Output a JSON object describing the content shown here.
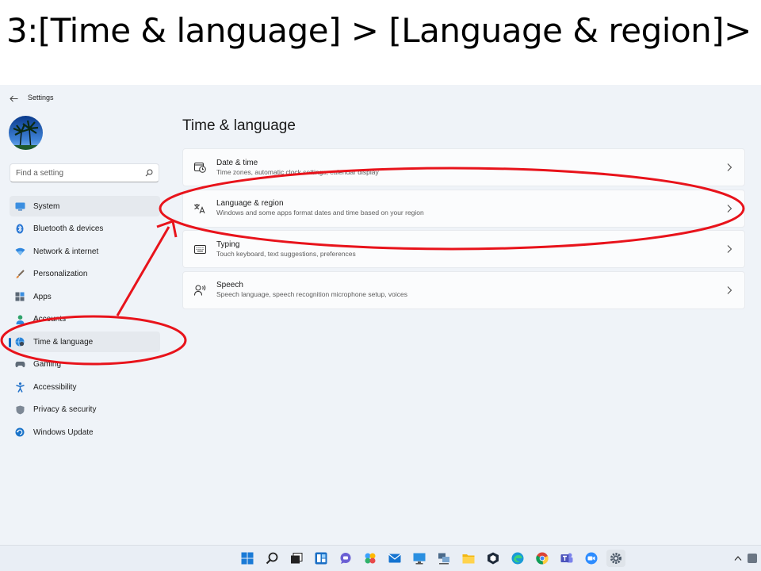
{
  "slide": {
    "title": "3:[Time & language] > [Language & region]>"
  },
  "window": {
    "app_title": "Settings"
  },
  "search": {
    "placeholder": "Find a setting"
  },
  "sidebar": {
    "items": [
      {
        "label": "System",
        "icon": "monitor-icon"
      },
      {
        "label": "Bluetooth & devices",
        "icon": "bluetooth-icon"
      },
      {
        "label": "Network & internet",
        "icon": "wifi-icon"
      },
      {
        "label": "Personalization",
        "icon": "brush-icon"
      },
      {
        "label": "Apps",
        "icon": "apps-icon"
      },
      {
        "label": "Accounts",
        "icon": "person-icon"
      },
      {
        "label": "Time & language",
        "icon": "globe-clock-icon",
        "selected": true
      },
      {
        "label": "Gaming",
        "icon": "gamepad-icon"
      },
      {
        "label": "Accessibility",
        "icon": "accessibility-icon"
      },
      {
        "label": "Privacy & security",
        "icon": "shield-icon"
      },
      {
        "label": "Windows Update",
        "icon": "update-icon"
      }
    ]
  },
  "main": {
    "heading": "Time & language",
    "cards": [
      {
        "title": "Date & time",
        "desc": "Time zones, automatic clock settings, calendar display",
        "icon": "calendar-clock-icon"
      },
      {
        "title": "Language & region",
        "desc": "Windows and some apps format dates and time based on your region",
        "icon": "language-icon"
      },
      {
        "title": "Typing",
        "desc": "Touch keyboard, text suggestions, preferences",
        "icon": "keyboard-icon"
      },
      {
        "title": "Speech",
        "desc": "Speech language, speech recognition microphone setup, voices",
        "icon": "speech-icon"
      }
    ]
  },
  "taskbar": {
    "icons": [
      "start-icon",
      "search-icon",
      "task-view-icon",
      "widgets-icon",
      "chat-icon",
      "photos-icon",
      "mail-icon",
      "desktop-icon",
      "network-share-icon",
      "file-explorer-icon",
      "app-shield-icon",
      "edge-icon",
      "chrome-icon",
      "teams-icon",
      "zoom-icon",
      "settings-icon"
    ]
  },
  "colors": {
    "accent": "#0067c0",
    "annotation": "#e8131b",
    "background": "#eff3f8"
  }
}
